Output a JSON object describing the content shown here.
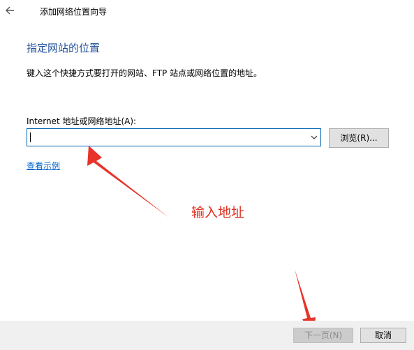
{
  "window": {
    "title": "添加网络位置向导"
  },
  "page": {
    "heading": "指定网站的位置",
    "description": "键入这个快捷方式要打开的网站、FTP 站点或网络位置的地址。"
  },
  "address": {
    "label": "Internet 地址或网络地址(A):",
    "value": ""
  },
  "buttons": {
    "browse": "浏览(R)...",
    "next": "下一页(N)",
    "cancel": "取消"
  },
  "link": {
    "example": "查看示例"
  },
  "annotation": {
    "text": "输入地址",
    "color": "#e03020"
  },
  "colors": {
    "heading": "#1f4e9a",
    "link": "#0066cc",
    "focus_border": "#0063b1"
  },
  "icons": {
    "back": "back-arrow-icon",
    "dropdown": "chevron-down-icon"
  }
}
